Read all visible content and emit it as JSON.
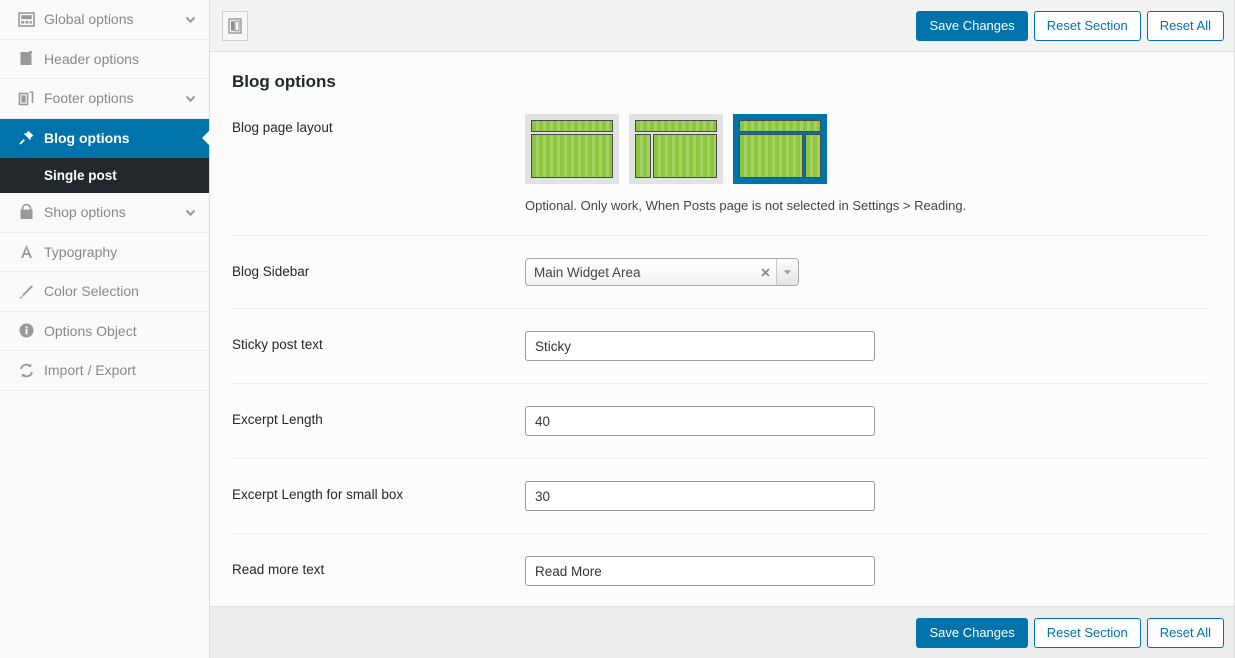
{
  "sidebar": {
    "items": [
      {
        "label": "Global options",
        "icon": "dashboard-icon",
        "has_chevron": true,
        "active": false
      },
      {
        "label": "Header options",
        "icon": "page-icon",
        "has_chevron": false,
        "active": false
      },
      {
        "label": "Footer options",
        "icon": "layers-icon",
        "has_chevron": true,
        "active": false
      },
      {
        "label": "Blog options",
        "icon": "pin-icon",
        "has_chevron": false,
        "active": true
      },
      {
        "label": "Shop options",
        "icon": "shopping-bag-icon",
        "has_chevron": true,
        "active": false
      },
      {
        "label": "Typography",
        "icon": "letter-a-icon",
        "has_chevron": false,
        "active": false
      },
      {
        "label": "Color Selection",
        "icon": "brush-icon",
        "has_chevron": false,
        "active": false
      },
      {
        "label": "Options Object",
        "icon": "info-icon",
        "has_chevron": false,
        "active": false
      },
      {
        "label": "Import / Export",
        "icon": "sync-icon",
        "has_chevron": false,
        "active": false
      }
    ],
    "subitem": {
      "label": "Single post"
    }
  },
  "toolbar": {
    "toggle_icon": "panel-toggle-icon",
    "save_label": "Save Changes",
    "reset_section_label": "Reset Section",
    "reset_all_label": "Reset All"
  },
  "footer": {
    "save_label": "Save Changes",
    "reset_section_label": "Reset Section",
    "reset_all_label": "Reset All"
  },
  "main": {
    "title": "Blog options",
    "fields": {
      "blog_page_layout": {
        "label": "Blog page layout",
        "help": "Optional. Only work, When Posts page is not selected in Settings > Reading.",
        "options": [
          {
            "name": "full-width-layout",
            "selected": false
          },
          {
            "name": "left-sidebar-layout",
            "selected": false
          },
          {
            "name": "right-sidebar-layout",
            "selected": true
          }
        ]
      },
      "blog_sidebar": {
        "label": "Blog Sidebar",
        "value": "Main Widget Area",
        "clear_icon": "close-icon",
        "arrow_icon": "chevron-down-icon"
      },
      "sticky_post_text": {
        "label": "Sticky post text",
        "value": "Sticky"
      },
      "excerpt_length": {
        "label": "Excerpt Length",
        "value": "40"
      },
      "excerpt_length_small": {
        "label": "Excerpt Length for small box",
        "value": "30"
      },
      "read_more_text": {
        "label": "Read more text",
        "value": "Read More"
      }
    }
  },
  "colors": {
    "accent": "#0073aa",
    "dark": "#23282d",
    "thumb_green": "#8cc63e"
  }
}
